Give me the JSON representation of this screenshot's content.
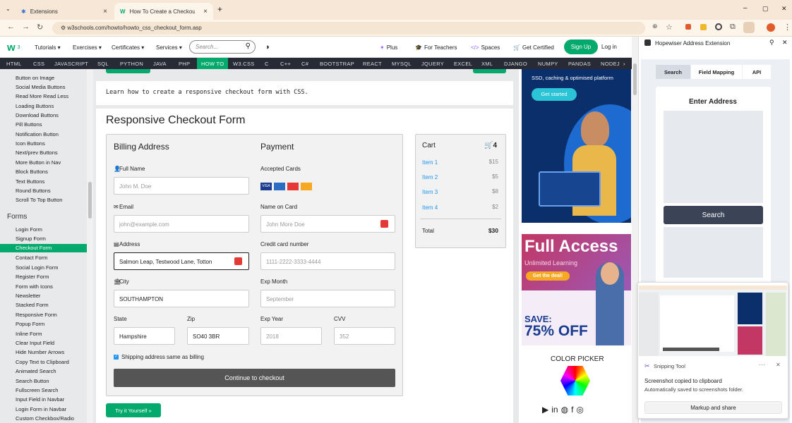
{
  "browser": {
    "tabs": [
      {
        "title": "Extensions"
      },
      {
        "title": "How To Create a Checkout Form"
      }
    ],
    "url": "w3schools.com/howto/howto_css_checkout_form.asp",
    "win_min": "–",
    "win_max": "▢",
    "win_close": "✕"
  },
  "site": {
    "nav": [
      "Tutorials ▾",
      "Exercises ▾",
      "Certificates ▾",
      "Services ▾"
    ],
    "search_placeholder": "Search...",
    "right": [
      "Plus",
      "For Teachers",
      "Spaces",
      "Get Certified"
    ],
    "signup": "Sign Up",
    "login": "Log in",
    "topnav": [
      "HTML",
      "CSS",
      "JAVASCRIPT",
      "SQL",
      "PYTHON",
      "JAVA",
      "PHP",
      "HOW TO",
      "W3.CSS",
      "C",
      "C++",
      "C#",
      "BOOTSTRAP",
      "REACT",
      "MYSQL",
      "JQUERY",
      "EXCEL",
      "XML",
      "DJANGO",
      "NUMPY",
      "PANDAS",
      "NODEJ"
    ]
  },
  "sidebar": {
    "items_top": [
      "Button on Image",
      "Social Media Buttons",
      "Read More Read Less",
      "Loading Buttons",
      "Download Buttons",
      "Pill Buttons",
      "Notification Button",
      "Icon Buttons",
      "Next/prev Buttons",
      "More Button in Nav",
      "Block Buttons",
      "Text Buttons",
      "Round Buttons",
      "Scroll To Top Button"
    ],
    "section": "Forms",
    "items_forms": [
      "Login Form",
      "Signup Form",
      "Checkout Form",
      "Contact Form",
      "Social Login Form",
      "Register Form",
      "Form with Icons",
      "Newsletter",
      "Stacked Form",
      "Responsive Form",
      "Popup Form",
      "Inline Form",
      "Clear Input Field",
      "Hide Number Arrows",
      "Copy Text to Clipboard",
      "Animated Search",
      "Search Button",
      "Fullscreen Search",
      "Input Field in Navbar",
      "Login Form in Navbar",
      "Custom Checkbox/Radio"
    ]
  },
  "main": {
    "intro": "Learn how to create a responsive checkout form with CSS.",
    "heading": "Responsive Checkout Form",
    "billing": "Billing Address",
    "payment": "Payment",
    "fullname_label": "Full Name",
    "fullname_ph": "John M. Doe",
    "email_label": "Email",
    "email_ph": "john@example.com",
    "address_label": "Address",
    "address_val": "Salmon Leap, Testwood Lane, Totton",
    "city_label": "City",
    "city_val": "SOUTHAMPTON",
    "state_label": "State",
    "state_val": "Hampshire",
    "zip_label": "Zip",
    "zip_val": "SO40 3BR",
    "cards_label": "Accepted Cards",
    "name_card_label": "Name on Card",
    "name_card_ph": "John More Doe",
    "ccnum_label": "Credit card number",
    "ccnum_ph": "1111-2222-3333-4444",
    "expmonth_label": "Exp Month",
    "expmonth_ph": "September",
    "expyear_label": "Exp Year",
    "expyear_ph": "2018",
    "cvv_label": "CVV",
    "cvv_ph": "352",
    "shipping": "Shipping address same as billing",
    "checkout": "Continue to checkout",
    "tryit": "Try it Yourself »",
    "cart": {
      "title": "Cart",
      "count": "4",
      "items": [
        {
          "name": "Item 1",
          "price": "$15"
        },
        {
          "name": "Item 2",
          "price": "$5"
        },
        {
          "name": "Item 3",
          "price": "$8"
        },
        {
          "name": "Item 4",
          "price": "$2"
        }
      ],
      "total_label": "Total",
      "total": "$30"
    }
  },
  "ads": {
    "ad1_text": "SSD, caching & optimised platform",
    "ad1_btn": "Get started",
    "ad2_title": "Full Access",
    "ad2_sub": "Unlimited Learning",
    "ad2_btn": "Get the deal!",
    "ad2_save": "SAVE:",
    "ad2_off": "75% OFF",
    "color_picker": "COLOR PICKER"
  },
  "extension": {
    "title": "Hopewiser Address Extension",
    "tabs": [
      "Search",
      "Field Mapping",
      "API"
    ],
    "enter": "Enter Address",
    "search_btn": "Search"
  },
  "snipping": {
    "app": "Snipping Tool",
    "msg1": "Screenshot copied to clipboard",
    "msg2": "Automatically saved to screenshots folder.",
    "action": "Markup and share"
  },
  "colors": {
    "green": "#04aa6d",
    "dark": "#282a35",
    "blue": "#2196f3"
  }
}
